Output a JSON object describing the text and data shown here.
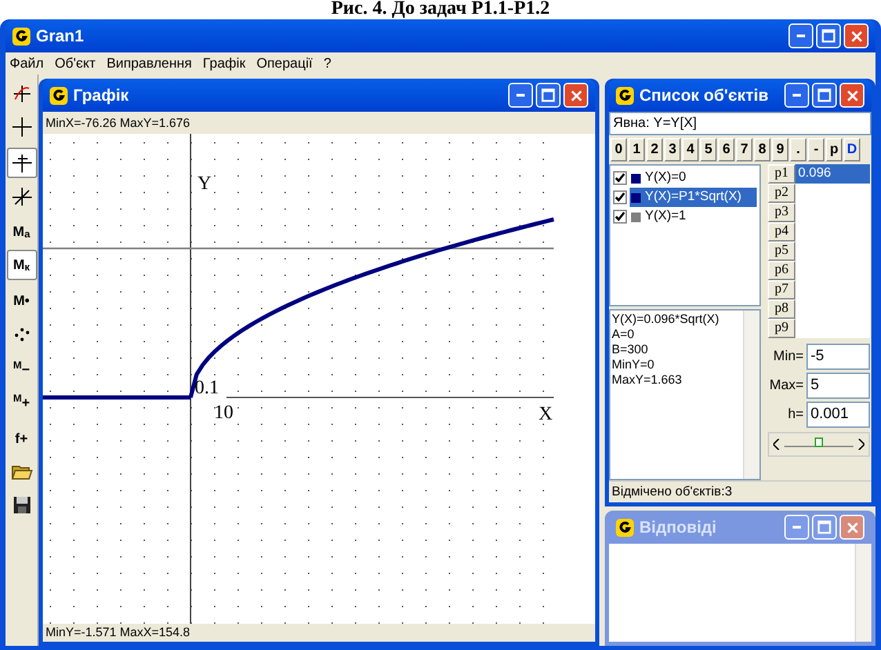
{
  "caption": "Рис. 4. До задач Р1.1-Р1.2",
  "window": {
    "title": "Gran1"
  },
  "menu": [
    "Файл",
    "Об'єкт",
    "Виправлення",
    "Графік",
    "Операції",
    "?"
  ],
  "tools": [
    {
      "kind": "axes",
      "pressed": false
    },
    {
      "kind": "cross",
      "pressed": false
    },
    {
      "kind": "pin",
      "pressed": true
    },
    {
      "kind": "slant",
      "pressed": false
    },
    {
      "kind": "text",
      "label": "M$_{a}$",
      "pressed": false
    },
    {
      "kind": "text",
      "label": "M$_{к}$",
      "pressed": true
    },
    {
      "kind": "text",
      "label": "M•",
      "pressed": false
    },
    {
      "kind": "scatter",
      "pressed": false
    },
    {
      "kind": "text",
      "label": "$^{M}$−",
      "pressed": false
    },
    {
      "kind": "text",
      "label": "$^{M}$+",
      "pressed": false
    },
    {
      "kind": "text",
      "label": "f+",
      "pressed": false
    },
    {
      "kind": "open",
      "pressed": false
    },
    {
      "kind": "save",
      "pressed": false
    }
  ],
  "graph": {
    "title": "Графік",
    "top_status": "MinX=-76.26  MaxY=1.676",
    "bottom_status": "MinY=-1.571  MaxX=154.8",
    "y_axis_label": "Y",
    "x_axis_label": "X",
    "y_tick": "0.1",
    "x_tick": "10"
  },
  "objects": {
    "title": "Список об'єктів",
    "mode": "Явна: Y=Y[X]",
    "keys": [
      "0",
      "1",
      "2",
      "3",
      "4",
      "5",
      "6",
      "7",
      "8",
      "9",
      ".",
      "-",
      "p",
      "D"
    ],
    "items": [
      {
        "label": "Y(X)=0",
        "checked": true,
        "selected": false,
        "color": "#000080"
      },
      {
        "label": "Y(X)=P1*Sqrt(X)",
        "checked": true,
        "selected": true,
        "color": "#000080"
      },
      {
        "label": "Y(X)=1",
        "checked": true,
        "selected": false,
        "color": "#808080"
      }
    ],
    "params": [
      {
        "name": "p1",
        "value": "0.096"
      },
      {
        "name": "p2"
      },
      {
        "name": "p3"
      },
      {
        "name": "p4"
      },
      {
        "name": "p5"
      },
      {
        "name": "p6"
      },
      {
        "name": "p7"
      },
      {
        "name": "p8"
      },
      {
        "name": "p9"
      }
    ],
    "info": [
      "Y(X)=0.096*Sqrt(X)",
      "A=0",
      "B=300",
      "MinY=0",
      "MaxY=1.663"
    ],
    "min_label": "Min=",
    "min": "-5",
    "max_label": "Max=",
    "max": "5",
    "h_label": "h=",
    "h": "0.001",
    "slider": {
      "level": 0.5
    },
    "status": "Відмічено об'єктів:3"
  },
  "answers": {
    "title": "Відповіді"
  }
}
